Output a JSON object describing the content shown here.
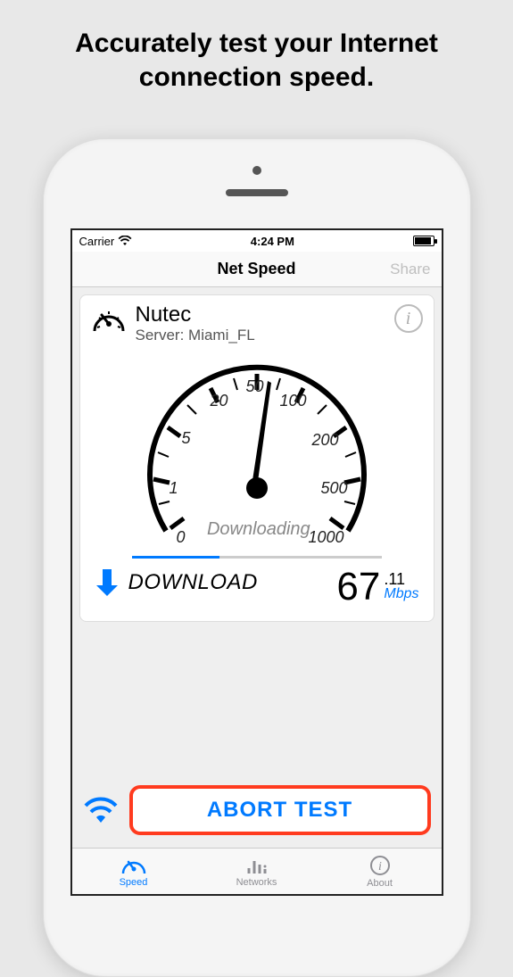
{
  "promo": {
    "line1": "Accurately test your Internet",
    "line2": "connection speed."
  },
  "status_bar": {
    "carrier": "Carrier",
    "time": "4:24 PM"
  },
  "nav": {
    "title": "Net Speed",
    "share": "Share"
  },
  "provider": {
    "name": "Nutec",
    "server_prefix": "Server: ",
    "server": "Miami_FL"
  },
  "gauge": {
    "ticks": [
      "0",
      "1",
      "5",
      "20",
      "50",
      "100",
      "200",
      "500",
      "1000"
    ],
    "status_text": "Downloading",
    "progress_percent": 35
  },
  "result": {
    "download_label": "DOWNLOAD",
    "value_int": "67",
    "value_frac": ".11",
    "unit": "Mbps"
  },
  "action": {
    "abort": "ABORT TEST"
  },
  "tabs": {
    "speed": "Speed",
    "networks": "Networks",
    "about": "About"
  },
  "chart_data": {
    "type": "gauge",
    "title": "Net Speed",
    "ticks": [
      0,
      1,
      5,
      20,
      50,
      100,
      200,
      500,
      1000
    ],
    "current_value": 67.11,
    "unit": "Mbps",
    "status": "Downloading",
    "progress": 0.35,
    "range": [
      0,
      1000
    ]
  }
}
